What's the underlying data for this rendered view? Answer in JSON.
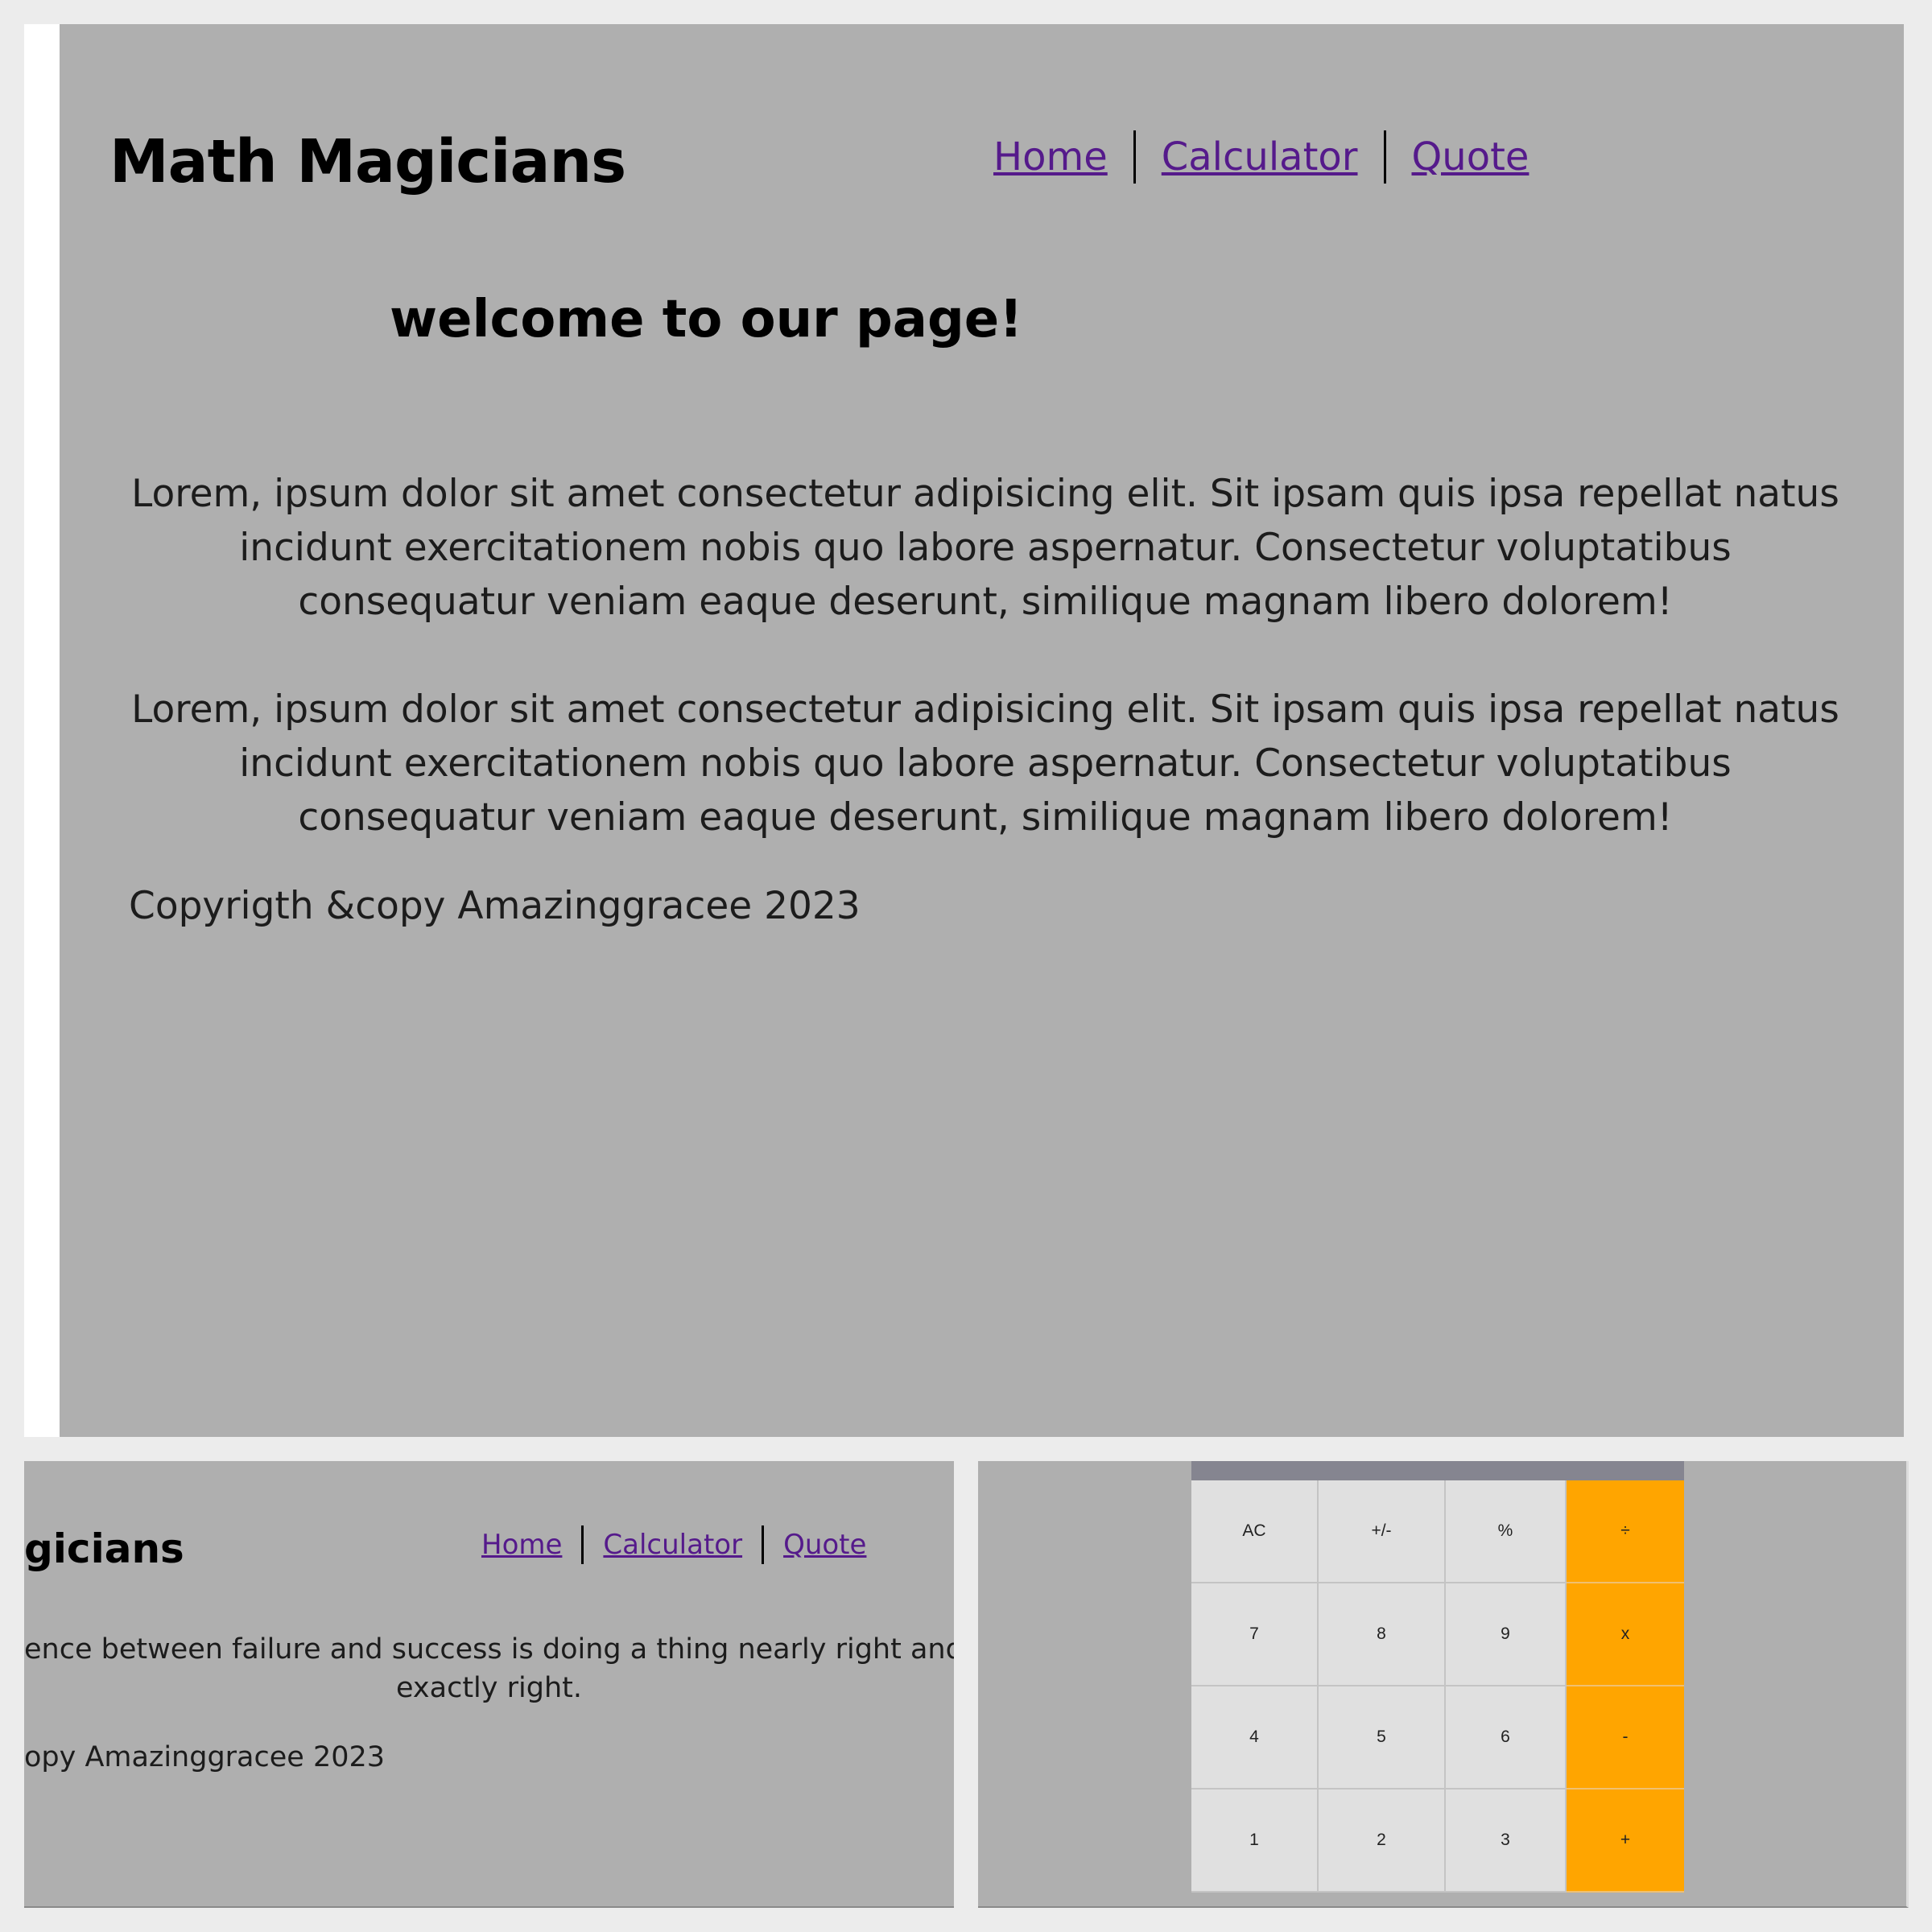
{
  "app": {
    "logo": "Math Magicians",
    "logo_cropped": "gicians"
  },
  "nav": {
    "home": "Home",
    "calculator": "Calculator",
    "quote": "Quote"
  },
  "home_page": {
    "heading": "welcome to our page!",
    "paragraphs": [
      "Lorem, ipsum dolor sit amet consectetur adipisicing elit. Sit ipsam quis ipsa repellat natus incidunt exercitationem nobis quo labore aspernatur. Consectetur voluptatibus consequatur veniam eaque deserunt, similique magnam libero dolorem!",
      "Lorem, ipsum dolor sit amet consectetur adipisicing elit. Sit ipsam quis ipsa repellat natus incidunt exercitationem nobis quo labore aspernatur. Consectetur voluptatibus consequatur veniam eaque deserunt, similique magnam libero dolorem!"
    ],
    "copyright": "Copyrigth &copy Amazinggracee 2023"
  },
  "quote_page": {
    "quote_line_1": "ence between failure and success is doing a thing nearly right and doir",
    "quote_line_2": "exactly right.",
    "copyright": "opy Amazinggracee 2023"
  },
  "calculator": {
    "display": "",
    "keys": [
      [
        "AC",
        "+/-",
        "%",
        "÷"
      ],
      [
        "7",
        "8",
        "9",
        "x"
      ],
      [
        "4",
        "5",
        "6",
        "-"
      ],
      [
        "1",
        "2",
        "3",
        "+"
      ]
    ]
  },
  "colors": {
    "page_background": "#afafaf",
    "link": "#551a8b",
    "operator_key": "#ffa500",
    "key": "#e0e0e0",
    "display": "#858590"
  }
}
